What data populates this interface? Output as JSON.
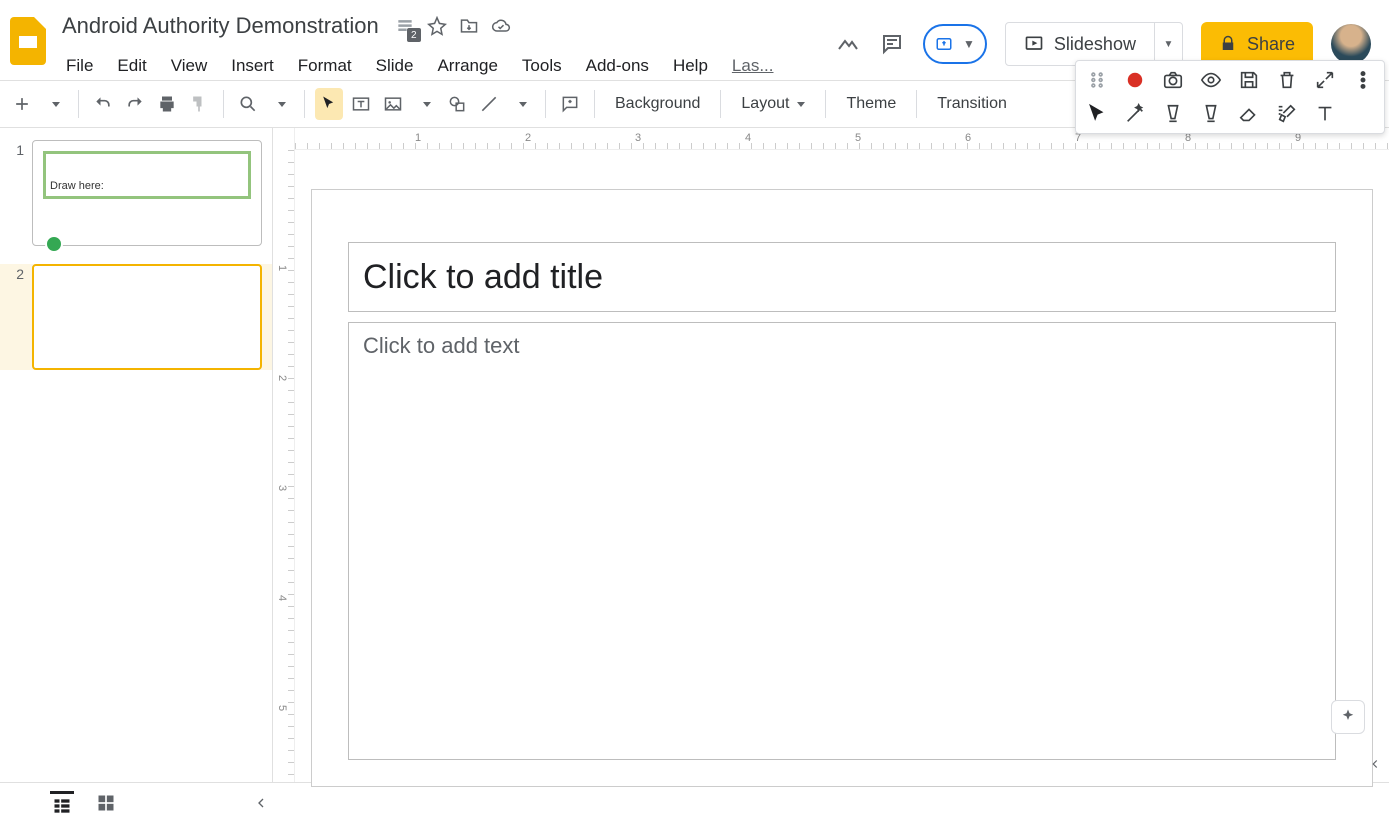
{
  "doc": {
    "title": "Android Authority Demonstration"
  },
  "activity_badge": "2",
  "menus": [
    "File",
    "Edit",
    "View",
    "Insert",
    "Format",
    "Slide",
    "Arrange",
    "Tools",
    "Add-ons",
    "Help",
    "Las..."
  ],
  "header": {
    "slideshow": "Slideshow",
    "share": "Share"
  },
  "toolbar": {
    "background": "Background",
    "layout": "Layout",
    "theme": "Theme",
    "transition": "Transition"
  },
  "filmstrip": {
    "slides": [
      {
        "num": "1",
        "content": "Draw here:"
      },
      {
        "num": "2",
        "content": ""
      }
    ]
  },
  "canvas": {
    "title_placeholder": "Click to add title",
    "body_placeholder": "Click to add text",
    "hruler_ticks": [
      "1",
      "2",
      "3",
      "4",
      "5",
      "6",
      "7",
      "8",
      "9"
    ],
    "vruler_ticks": [
      "1",
      "2",
      "3",
      "4",
      "5"
    ]
  }
}
